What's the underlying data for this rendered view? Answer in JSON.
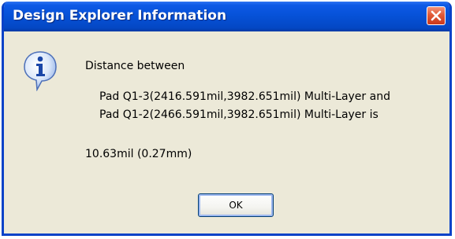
{
  "dialog": {
    "title": "Design Explorer Information",
    "icon": "information-icon",
    "message": {
      "intro": "Distance between",
      "line1": "Pad Q1-3(2416.591mil,3982.651mil)  Multi-Layer and",
      "line2": "Pad Q1-2(2466.591mil,3982.651mil)  Multi-Layer is",
      "result": "10.63mil  (0.27mm)"
    },
    "ok_label": "OK",
    "close_icon": "close-icon"
  },
  "colors": {
    "titlebar": "#0651d6",
    "frame": "#0842c8",
    "body": "#ece9d8",
    "close_button": "#e15a37"
  }
}
